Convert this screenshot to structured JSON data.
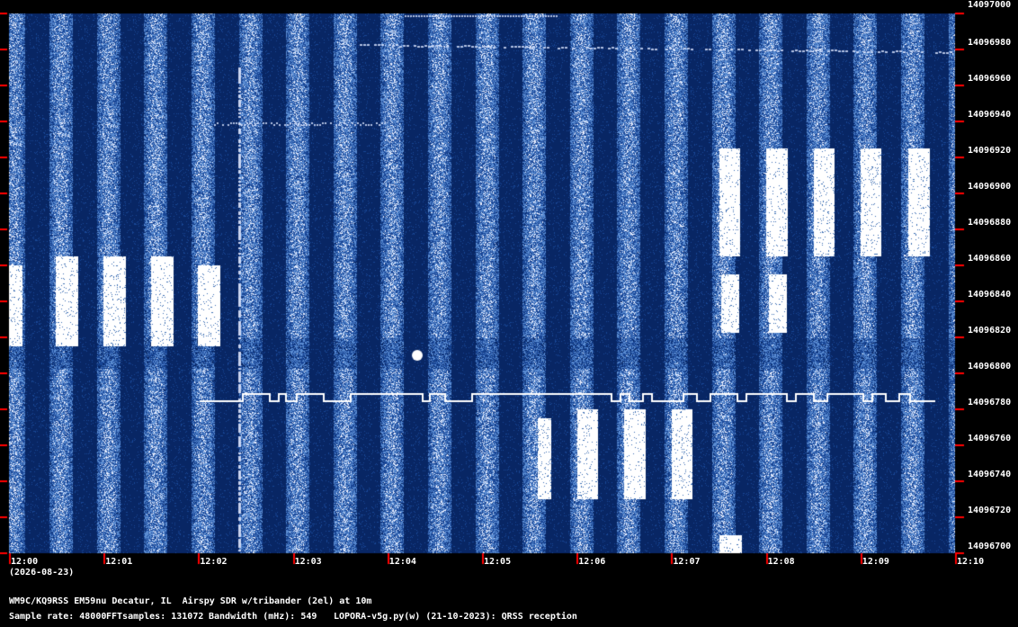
{
  "plot": {
    "type": "waterfall-spectrogram",
    "background": "#0a2d6b",
    "signal_color": "#ffffff",
    "tick_color": "#ff0000",
    "xlim": [
      "12:00",
      "12:10"
    ],
    "ylim": [
      14096700,
      14097000
    ],
    "y_ticks": [
      "14097000",
      "14096980",
      "14096960",
      "14096940",
      "14096920",
      "14096900",
      "14096880",
      "14096860",
      "14096840",
      "14096820",
      "14096800",
      "14096780",
      "14096760",
      "14096740",
      "14096720",
      "14096700"
    ],
    "x_ticks": [
      "12:00",
      "12:01",
      "12:02",
      "12:03",
      "12:04",
      "12:05",
      "12:06",
      "12:07",
      "12:08",
      "12:09",
      "12:10"
    ]
  },
  "date_label": "(2026-08-23)",
  "footer": {
    "station": "WM9C/KQ9RSS EM59nu Decatur, IL  Airspy SDR w/tribander (2el) at 10m",
    "sample_rate": "Sample rate: 48000",
    "fft_samples": "FFTsamples: 131072",
    "bandwidth": "Bandwidth (mHz): 549",
    "software": "LOPORA-v5g.py(w) (21-10-2023): QRSS reception"
  }
}
